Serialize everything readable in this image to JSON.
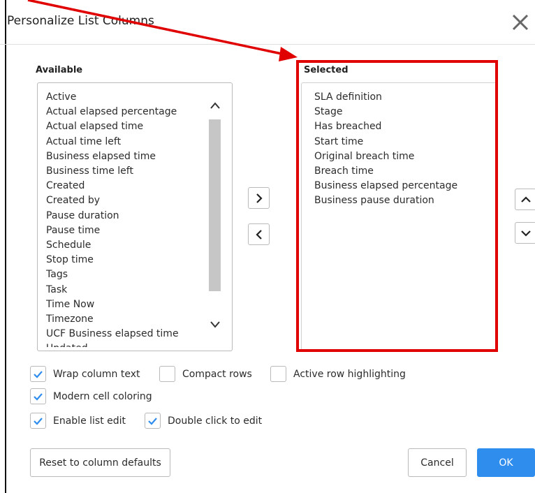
{
  "dialog": {
    "title": "Personalize List Columns",
    "close_icon": "close-icon"
  },
  "available": {
    "label": "Available",
    "items": [
      "Active",
      "Actual elapsed percentage",
      "Actual elapsed time",
      "Actual time left",
      "Business elapsed time",
      "Business time left",
      "Created",
      "Created by",
      "Pause duration",
      "Pause time",
      "Schedule",
      "Stop time",
      "Tags",
      "Task",
      "Time Now",
      "Timezone",
      "UCF Business elapsed time",
      "Updated"
    ]
  },
  "selected": {
    "label": "Selected",
    "items": [
      "SLA definition",
      "Stage",
      "Has breached",
      "Start time",
      "Original breach time",
      "Breach time",
      "Business elapsed percentage",
      "Business pause duration"
    ]
  },
  "move_buttons": {
    "add_icon": "chevron-right-icon",
    "remove_icon": "chevron-left-icon",
    "up_icon": "chevron-up-icon",
    "down_icon": "chevron-down-icon"
  },
  "options": {
    "wrap_column_text": {
      "label": "Wrap column text",
      "checked": true
    },
    "compact_rows": {
      "label": "Compact rows",
      "checked": false
    },
    "active_row_highlighting": {
      "label": "Active row highlighting",
      "checked": false
    },
    "modern_cell_coloring": {
      "label": "Modern cell coloring",
      "checked": true
    },
    "enable_list_edit": {
      "label": "Enable list edit",
      "checked": true
    },
    "double_click_to_edit": {
      "label": "Double click to edit",
      "checked": true
    }
  },
  "footer": {
    "reset_label": "Reset to column defaults",
    "cancel_label": "Cancel",
    "ok_label": "OK"
  },
  "colors": {
    "primary": "#2f8ded",
    "annotation": "#e00000",
    "check": "#2f8ded"
  }
}
